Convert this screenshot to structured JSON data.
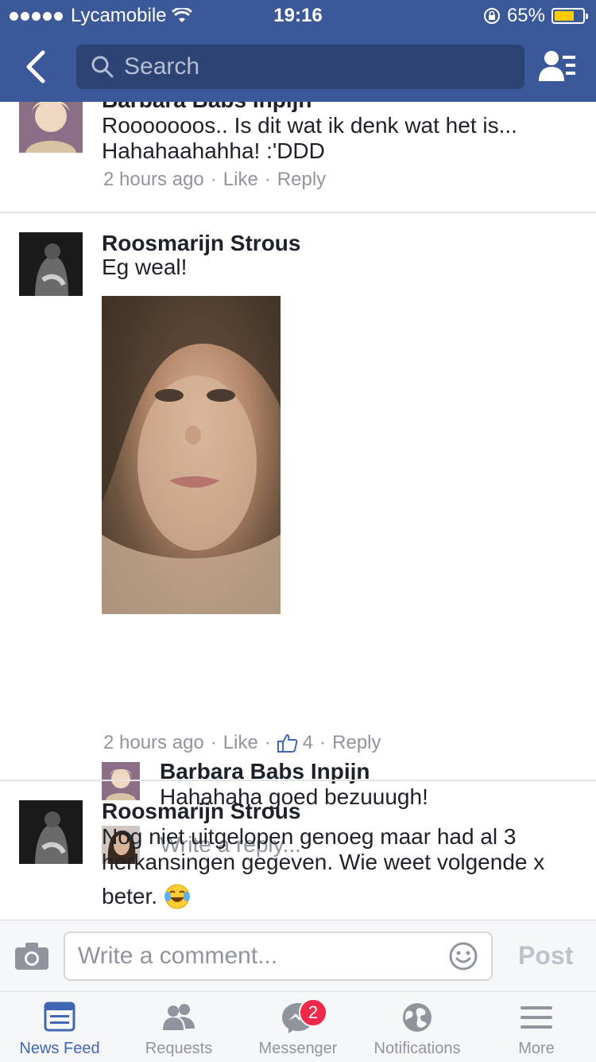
{
  "status_bar": {
    "carrier": "Lycamobile",
    "time": "19:16",
    "battery": "65%"
  },
  "header": {
    "search_placeholder": "Search"
  },
  "comments": [
    {
      "name": "Barbara Babs Inpijn",
      "text_line1": "Rooooooos..  Is dit wat ik denk wat het is...",
      "text_line2": "Hahahaahahha! :'DDD",
      "time": "2 hours ago",
      "like": "Like",
      "reply": "Reply"
    },
    {
      "name": "Roosmarijn Strous",
      "text": "Eg weal!",
      "time": "2 hours ago",
      "like": "Like",
      "like_count": "4",
      "reply": "Reply",
      "reply_item": {
        "name": "Barbara Babs Inpijn",
        "text": "Hahahaha goed bezuuugh!"
      },
      "write_reply": "Write a reply..."
    },
    {
      "name": "Roosmarijn Strous",
      "text_line1": "Nog niet uitgelopen genoeg maar had al 3",
      "text_line2": "herkansingen gegeven. Wie weet volgende x",
      "text_line3": "beter."
    }
  ],
  "composer": {
    "placeholder": "Write a comment...",
    "post": "Post"
  },
  "tabs": [
    {
      "label": "News Feed",
      "icon": "news-feed-icon"
    },
    {
      "label": "Requests",
      "icon": "friend-requests-icon"
    },
    {
      "label": "Messenger",
      "icon": "messenger-icon",
      "badge": "2"
    },
    {
      "label": "Notifications",
      "icon": "globe-icon"
    },
    {
      "label": "More",
      "icon": "menu-icon"
    }
  ],
  "colors": {
    "brand": "#3b5998",
    "active_tab": "#4267b2",
    "badge": "#f02849",
    "battery": "#ffcc00"
  }
}
